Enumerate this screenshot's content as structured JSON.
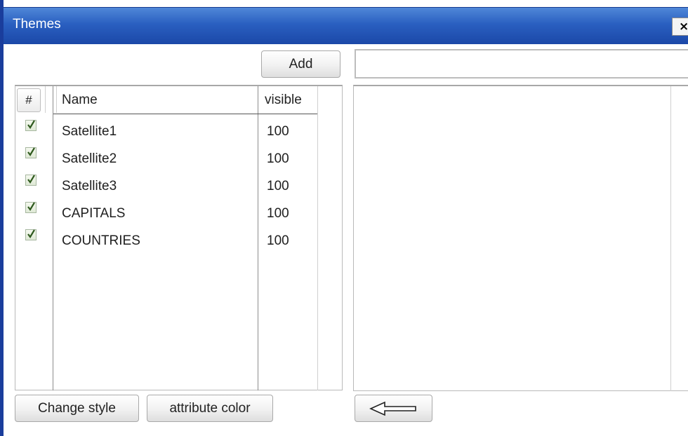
{
  "window": {
    "title": "Themes",
    "close_label": "×"
  },
  "toolbar": {
    "add_label": "Add",
    "input_value": ""
  },
  "layer_list": {
    "columns": {
      "select": "#",
      "name": "Name",
      "visible": "visible"
    },
    "rows": [
      {
        "checked": true,
        "name": "Satellite1",
        "visible": "100"
      },
      {
        "checked": true,
        "name": "Satellite2",
        "visible": "100"
      },
      {
        "checked": true,
        "name": "Satellite3",
        "visible": "100"
      },
      {
        "checked": true,
        "name": "CAPITALS",
        "visible": "100"
      },
      {
        "checked": true,
        "name": "COUNTRIES",
        "visible": "100"
      }
    ]
  },
  "buttons": {
    "change_style": "Change style",
    "attribute_color": "attribute color"
  },
  "icons": {
    "close": "close-icon",
    "checkbox": "checkmark-icon",
    "back": "arrow-left-icon"
  },
  "colors": {
    "title_bar": "#2a5fc0",
    "window_border": "#1a3d9c"
  }
}
